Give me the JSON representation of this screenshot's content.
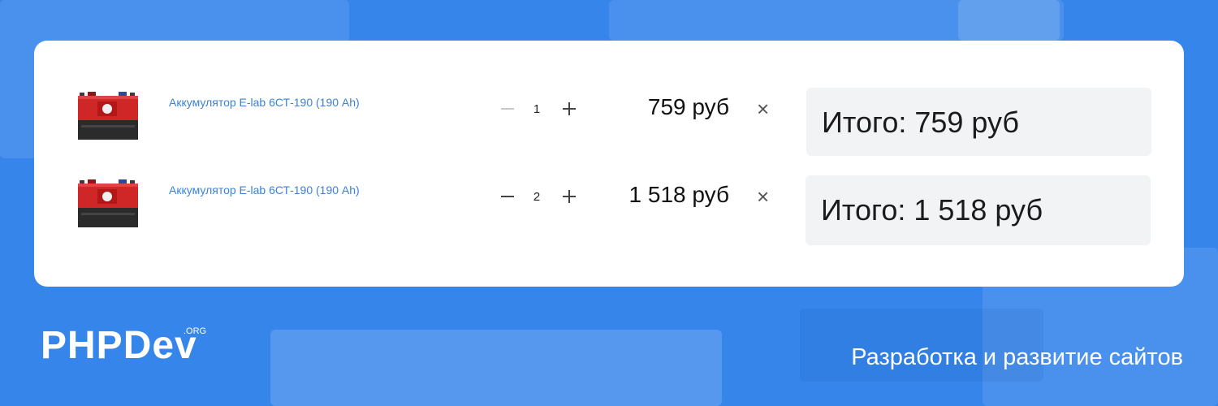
{
  "cart": {
    "items": [
      {
        "name": "Аккумулятор E-lab 6СТ-190 (190 Ah)",
        "qty": "1",
        "price": "759 руб",
        "total": "Итого: 759 руб",
        "minus_state": "disabled",
        "remove_label": "×"
      },
      {
        "name": "Аккумулятор E-lab 6СТ-190 (190 Ah)",
        "qty": "2",
        "price": "1 518 руб",
        "total": "Итого: 1 518 руб",
        "minus_state": "enabled",
        "remove_label": "×"
      }
    ]
  },
  "footer": {
    "logo_main": "PHPDev",
    "logo_suffix": ".ORG",
    "tagline": "Разработка и развитие сайтов"
  },
  "colors": {
    "background": "#3585ea",
    "link": "#3b82d6",
    "battery_body": "#cf2727",
    "battery_base": "#2b2b2b"
  },
  "icons": {
    "minus": "minus-icon",
    "plus": "plus-icon",
    "remove": "close-icon",
    "product": "car-battery-image"
  }
}
